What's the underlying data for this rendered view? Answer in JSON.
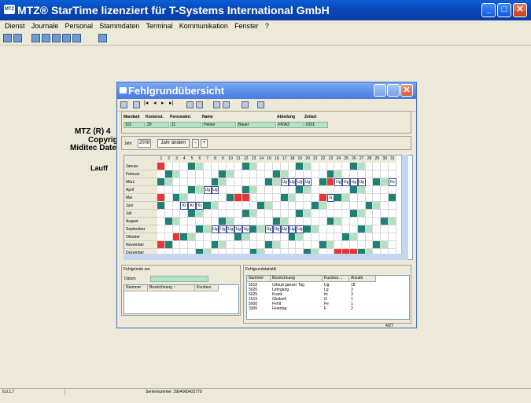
{
  "app": {
    "title": "MTZ® StarTime lizenziert für T-Systems International GmbH",
    "icon_text": "MTZ"
  },
  "menu": [
    "Dienst",
    "Journale",
    "Personal",
    "Stammdaten",
    "Terminal",
    "Kommunikation",
    "Fenster",
    "?"
  ],
  "background_text": {
    "line1": "MTZ (R) 4",
    "line2": "Copyrig",
    "line3": "Miditec Daten",
    "line4": "Lauff"
  },
  "window": {
    "title": "Fehlgrundübersicht",
    "icon_text": "MTZ",
    "headers": {
      "mandant_label": "Mandant",
      "mandant": "101",
      "kostenst_label": "Kostenst.",
      "kostenst": "29",
      "personalnr_label": "Personalnr.",
      "personalnr": "11",
      "name_label": "Name",
      "vorname": "Heiner",
      "nachname": "Bauer",
      "abteilung_label": "Abteilung",
      "abteilung": "FKW2",
      "zeitart_label": "Zeitart",
      "zeitart": "0101"
    },
    "year_label": "Jahr",
    "year_value": "2008",
    "change_year_button": "Jahr ändern",
    "prev_button": "−",
    "next_button": "+",
    "days": [
      "1",
      "2",
      "3",
      "4",
      "5",
      "6",
      "7",
      "8",
      "9",
      "10",
      "11",
      "12",
      "13",
      "14",
      "15",
      "16",
      "17",
      "18",
      "19",
      "20",
      "21",
      "22",
      "23",
      "24",
      "25",
      "26",
      "27",
      "28",
      "29",
      "30",
      "31"
    ],
    "months": [
      "Januar",
      "Februar",
      "März",
      "April",
      "Mai",
      "Juni",
      "Juli",
      "August",
      "September",
      "Oktober",
      "November",
      "Dezember"
    ],
    "cells": [
      {
        "m": 0,
        "d": 1,
        "c": "red"
      },
      {
        "m": 0,
        "d": 5,
        "c": "dark"
      },
      {
        "m": 0,
        "d": 12,
        "c": "dark"
      },
      {
        "m": 0,
        "d": 19,
        "c": "dark"
      },
      {
        "m": 0,
        "d": 26,
        "c": "dark"
      },
      {
        "m": 0,
        "d": 6,
        "c": "light"
      },
      {
        "m": 0,
        "d": 13,
        "c": "light"
      },
      {
        "m": 0,
        "d": 20,
        "c": "light"
      },
      {
        "m": 0,
        "d": 27,
        "c": "light"
      },
      {
        "m": 1,
        "d": 2,
        "c": "dark"
      },
      {
        "m": 1,
        "d": 9,
        "c": "dark"
      },
      {
        "m": 1,
        "d": 16,
        "c": "dark"
      },
      {
        "m": 1,
        "d": 23,
        "c": "dark"
      },
      {
        "m": 1,
        "d": 3,
        "c": "light"
      },
      {
        "m": 1,
        "d": 10,
        "c": "light"
      },
      {
        "m": 1,
        "d": 17,
        "c": "light"
      },
      {
        "m": 1,
        "d": 24,
        "c": "light"
      },
      {
        "m": 2,
        "d": 1,
        "c": "dark"
      },
      {
        "m": 2,
        "d": 8,
        "c": "dark"
      },
      {
        "m": 2,
        "d": 15,
        "c": "dark"
      },
      {
        "m": 2,
        "d": 22,
        "c": "dark"
      },
      {
        "m": 2,
        "d": 29,
        "c": "dark"
      },
      {
        "m": 2,
        "d": 2,
        "c": "light"
      },
      {
        "m": 2,
        "d": 9,
        "c": "light"
      },
      {
        "m": 2,
        "d": 16,
        "c": "light"
      },
      {
        "m": 2,
        "d": 23,
        "c": "red"
      },
      {
        "m": 2,
        "d": 30,
        "c": "light"
      },
      {
        "m": 2,
        "d": 17,
        "t": "Ug"
      },
      {
        "m": 2,
        "d": 18,
        "t": "Ug"
      },
      {
        "m": 2,
        "d": 19,
        "t": "Ug"
      },
      {
        "m": 2,
        "d": 20,
        "t": "Ug"
      },
      {
        "m": 2,
        "d": 24,
        "t": "Ug"
      },
      {
        "m": 2,
        "d": 25,
        "t": "Ug"
      },
      {
        "m": 2,
        "d": 26,
        "t": "Ug"
      },
      {
        "m": 2,
        "d": 27,
        "t": "Ug"
      },
      {
        "m": 2,
        "d": 31,
        "t": "Fe"
      },
      {
        "m": 3,
        "d": 5,
        "c": "dark"
      },
      {
        "m": 3,
        "d": 12,
        "c": "dark"
      },
      {
        "m": 3,
        "d": 19,
        "c": "dark"
      },
      {
        "m": 3,
        "d": 26,
        "c": "dark"
      },
      {
        "m": 3,
        "d": 6,
        "c": "light"
      },
      {
        "m": 3,
        "d": 13,
        "c": "light"
      },
      {
        "m": 3,
        "d": 20,
        "c": "light"
      },
      {
        "m": 3,
        "d": 27,
        "c": "light"
      },
      {
        "m": 3,
        "d": 7,
        "t": "Ug"
      },
      {
        "m": 3,
        "d": 8,
        "t": "Ug"
      },
      {
        "m": 4,
        "d": 1,
        "c": "red"
      },
      {
        "m": 4,
        "d": 3,
        "c": "dark"
      },
      {
        "m": 4,
        "d": 10,
        "c": "dark"
      },
      {
        "m": 4,
        "d": 17,
        "c": "dark"
      },
      {
        "m": 4,
        "d": 24,
        "c": "dark"
      },
      {
        "m": 4,
        "d": 31,
        "c": "dark"
      },
      {
        "m": 4,
        "d": 4,
        "c": "light"
      },
      {
        "m": 4,
        "d": 11,
        "c": "red"
      },
      {
        "m": 4,
        "d": 12,
        "c": "red"
      },
      {
        "m": 4,
        "d": 18,
        "c": "light"
      },
      {
        "m": 4,
        "d": 25,
        "c": "light"
      },
      {
        "m": 4,
        "d": 22,
        "c": "red"
      },
      {
        "m": 4,
        "d": 23,
        "t": "G"
      },
      {
        "m": 5,
        "d": 1,
        "c": "dark"
      },
      {
        "m": 5,
        "d": 7,
        "c": "dark"
      },
      {
        "m": 5,
        "d": 14,
        "c": "dark"
      },
      {
        "m": 5,
        "d": 21,
        "c": "dark"
      },
      {
        "m": 5,
        "d": 28,
        "c": "dark"
      },
      {
        "m": 5,
        "d": 8,
        "c": "light"
      },
      {
        "m": 5,
        "d": 15,
        "c": "light"
      },
      {
        "m": 5,
        "d": 22,
        "c": "light"
      },
      {
        "m": 5,
        "d": 29,
        "c": "light"
      },
      {
        "m": 5,
        "d": 4,
        "t": "Kr"
      },
      {
        "m": 5,
        "d": 5,
        "t": "Kr"
      },
      {
        "m": 5,
        "d": 6,
        "t": "Kr"
      },
      {
        "m": 6,
        "d": 5,
        "c": "dark"
      },
      {
        "m": 6,
        "d": 12,
        "c": "dark"
      },
      {
        "m": 6,
        "d": 19,
        "c": "dark"
      },
      {
        "m": 6,
        "d": 26,
        "c": "dark"
      },
      {
        "m": 6,
        "d": 6,
        "c": "light"
      },
      {
        "m": 6,
        "d": 13,
        "c": "light"
      },
      {
        "m": 6,
        "d": 20,
        "c": "light"
      },
      {
        "m": 6,
        "d": 27,
        "c": "light"
      },
      {
        "m": 7,
        "d": 2,
        "c": "dark"
      },
      {
        "m": 7,
        "d": 9,
        "c": "dark"
      },
      {
        "m": 7,
        "d": 16,
        "c": "dark"
      },
      {
        "m": 7,
        "d": 23,
        "c": "dark"
      },
      {
        "m": 7,
        "d": 30,
        "c": "dark"
      },
      {
        "m": 7,
        "d": 3,
        "c": "light"
      },
      {
        "m": 7,
        "d": 10,
        "c": "light"
      },
      {
        "m": 7,
        "d": 17,
        "c": "light"
      },
      {
        "m": 7,
        "d": 24,
        "c": "light"
      },
      {
        "m": 7,
        "d": 31,
        "c": "light"
      },
      {
        "m": 8,
        "d": 6,
        "c": "dark"
      },
      {
        "m": 8,
        "d": 13,
        "c": "dark"
      },
      {
        "m": 8,
        "d": 20,
        "c": "dark"
      },
      {
        "m": 8,
        "d": 27,
        "c": "dark"
      },
      {
        "m": 8,
        "d": 7,
        "c": "light"
      },
      {
        "m": 8,
        "d": 14,
        "c": "light"
      },
      {
        "m": 8,
        "d": 21,
        "c": "light"
      },
      {
        "m": 8,
        "d": 28,
        "c": "light"
      },
      {
        "m": 8,
        "d": 8,
        "t": "Ug"
      },
      {
        "m": 8,
        "d": 9,
        "t": "Ug"
      },
      {
        "m": 8,
        "d": 10,
        "t": "Ug"
      },
      {
        "m": 8,
        "d": 11,
        "t": "Ug"
      },
      {
        "m": 8,
        "d": 12,
        "t": "Ug"
      },
      {
        "m": 8,
        "d": 15,
        "t": "Ug"
      },
      {
        "m": 8,
        "d": 16,
        "t": "Ug"
      },
      {
        "m": 8,
        "d": 17,
        "t": "Ug"
      },
      {
        "m": 8,
        "d": 18,
        "t": "Ug"
      },
      {
        "m": 8,
        "d": 19,
        "t": "Ug"
      },
      {
        "m": 9,
        "d": 3,
        "c": "red"
      },
      {
        "m": 9,
        "d": 4,
        "c": "dark"
      },
      {
        "m": 9,
        "d": 11,
        "c": "dark"
      },
      {
        "m": 9,
        "d": 18,
        "c": "dark"
      },
      {
        "m": 9,
        "d": 25,
        "c": "dark"
      },
      {
        "m": 9,
        "d": 5,
        "c": "light"
      },
      {
        "m": 9,
        "d": 12,
        "c": "light"
      },
      {
        "m": 9,
        "d": 19,
        "c": "light"
      },
      {
        "m": 9,
        "d": 26,
        "c": "light"
      },
      {
        "m": 10,
        "d": 1,
        "c": "red"
      },
      {
        "m": 10,
        "d": 2,
        "c": "dark"
      },
      {
        "m": 10,
        "d": 8,
        "c": "dark"
      },
      {
        "m": 10,
        "d": 15,
        "c": "dark"
      },
      {
        "m": 10,
        "d": 22,
        "c": "dark"
      },
      {
        "m": 10,
        "d": 29,
        "c": "dark"
      },
      {
        "m": 10,
        "d": 9,
        "c": "light"
      },
      {
        "m": 10,
        "d": 16,
        "c": "light"
      },
      {
        "m": 10,
        "d": 23,
        "c": "light"
      },
      {
        "m": 10,
        "d": 30,
        "c": "light"
      },
      {
        "m": 11,
        "d": 6,
        "c": "dark"
      },
      {
        "m": 11,
        "d": 13,
        "c": "dark"
      },
      {
        "m": 11,
        "d": 20,
        "c": "dark"
      },
      {
        "m": 11,
        "d": 27,
        "c": "dark"
      },
      {
        "m": 11,
        "d": 7,
        "c": "light"
      },
      {
        "m": 11,
        "d": 14,
        "c": "light"
      },
      {
        "m": 11,
        "d": 21,
        "c": "light"
      },
      {
        "m": 11,
        "d": 28,
        "c": "light"
      },
      {
        "m": 11,
        "d": 25,
        "c": "red"
      },
      {
        "m": 11,
        "d": 26,
        "c": "red"
      },
      {
        "m": 11,
        "d": 24,
        "c": "red"
      }
    ],
    "fehlgruende_am": {
      "title": "Fehlgründe am",
      "datum_label": "Datum",
      "columns": [
        "Nummer",
        "Bezeichnung ↑",
        "Kurzbez."
      ]
    },
    "statistik": {
      "title": "Fehlgrundstatistik",
      "columns": [
        "Nummer",
        "Bezeichnung",
        "Kurzbez. ↓",
        "Anzahl"
      ],
      "rows": [
        [
          "5510",
          "Urlaub ganzer Tag",
          "Ug",
          "18"
        ],
        [
          "5026",
          "Lehrgang",
          "Lg",
          "3"
        ],
        [
          "5025",
          "Krank",
          "Kr",
          "3"
        ],
        [
          "1515",
          "Gleitzeit",
          "G",
          "1"
        ],
        [
          "5000",
          "Fehlt",
          "Fe",
          "1"
        ],
        [
          "3300",
          "Feiertag",
          "F",
          "2"
        ]
      ]
    },
    "record_indicator": "4/27"
  },
  "status": {
    "version": "6.0.1.7",
    "serial": "Seriennummer: 2904000422779"
  },
  "colors": {
    "dark": "#1f8075",
    "light": "#b3e0c2",
    "red": "#e83535",
    "weekend": "#1f8075"
  }
}
